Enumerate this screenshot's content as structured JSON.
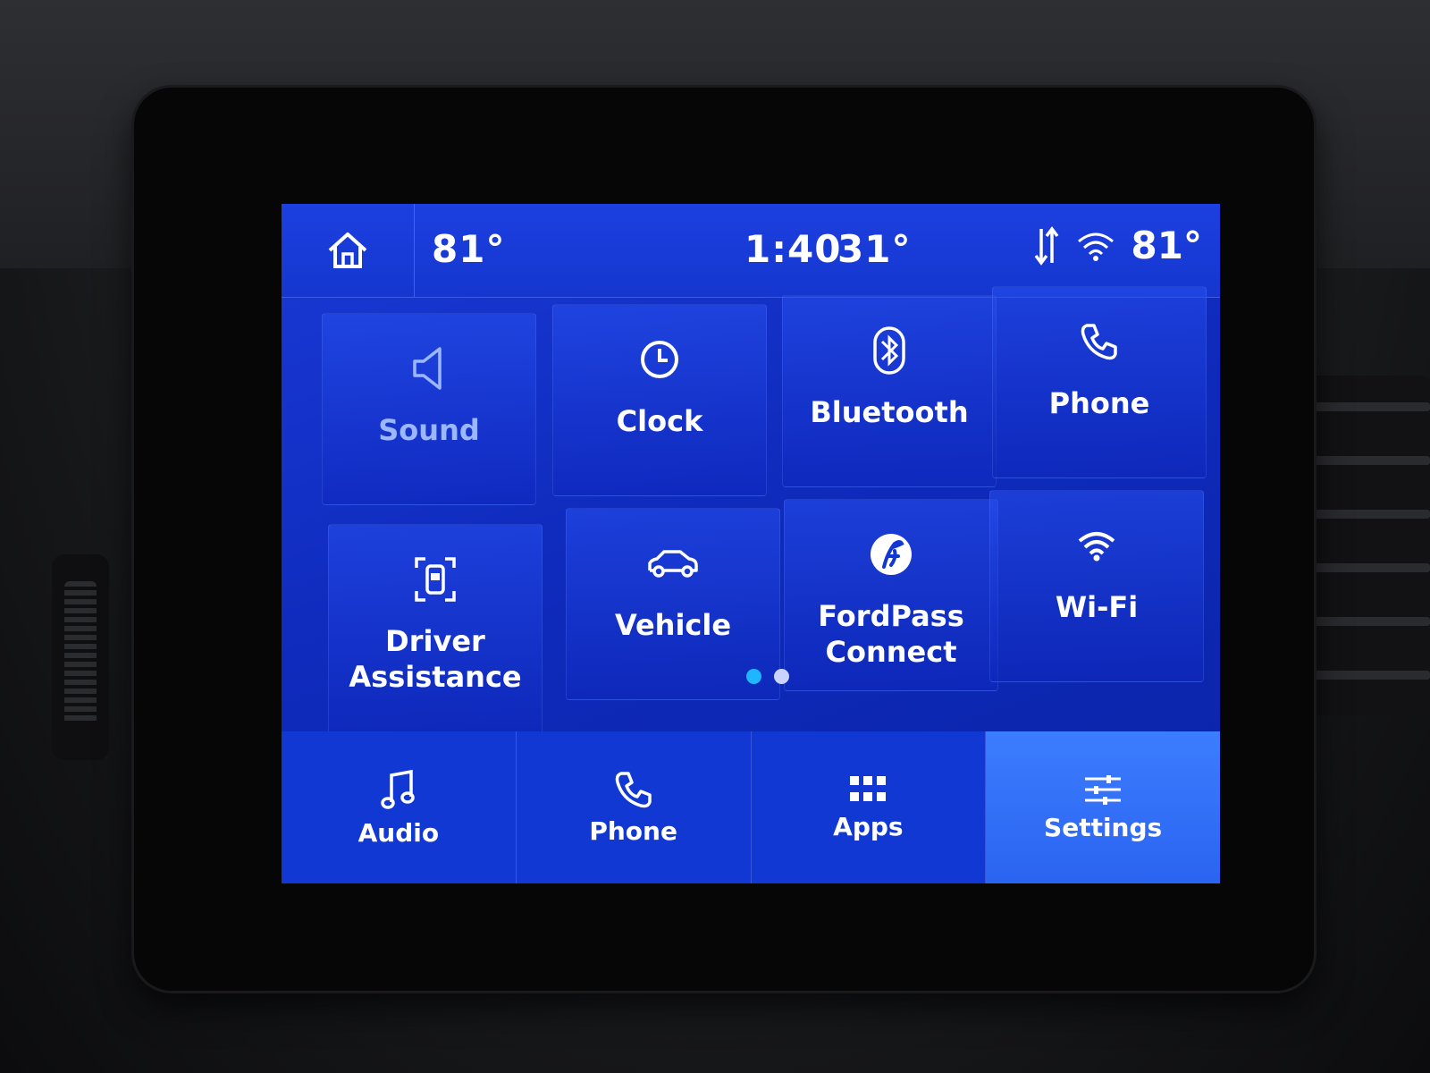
{
  "topbar": {
    "outside_temp_left": "81°",
    "time": "1:40",
    "inside_temp": "31°",
    "outside_temp_right": "81°"
  },
  "tiles": [
    {
      "label": "Sound",
      "icon": "speaker-icon",
      "dimmed": true
    },
    {
      "label": "Clock",
      "icon": "clock-icon"
    },
    {
      "label": "Bluetooth",
      "icon": "bluetooth-icon"
    },
    {
      "label": "Phone",
      "icon": "phone-icon"
    },
    {
      "label": "Driver\nAssistance",
      "icon": "driver-assist-icon"
    },
    {
      "label": "Vehicle",
      "icon": "car-icon"
    },
    {
      "label": "FordPass\nConnect",
      "icon": "fordpass-icon"
    },
    {
      "label": "Wi-Fi",
      "icon": "wifi-icon"
    }
  ],
  "page_indicator": {
    "pages": 2,
    "current": 1
  },
  "bottom_nav": [
    {
      "label": "Audio",
      "icon": "music-note-icon"
    },
    {
      "label": "Phone",
      "icon": "phone-icon"
    },
    {
      "label": "Apps",
      "icon": "apps-grid-icon"
    },
    {
      "label": "Settings",
      "icon": "sliders-icon",
      "active": true
    }
  ],
  "colors": {
    "screen_blue": "#1238d4",
    "active_tab": "#3c7dff",
    "dot_active": "#1fb6ff",
    "dot_inactive": "#c8d4ff",
    "dim_label": "#9bb8ff"
  }
}
